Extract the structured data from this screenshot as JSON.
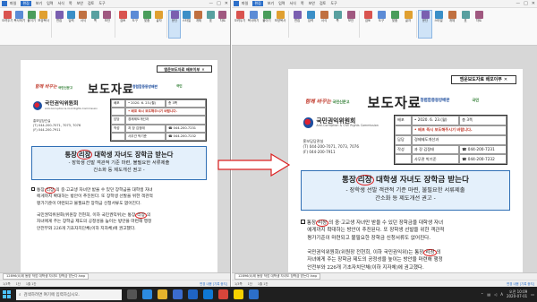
{
  "ribbon_buttons": [
    "오려두기",
    "복사하기",
    "붙이기",
    "모양복사",
    "편집",
    "입력",
    "서식",
    "쪽",
    "보안",
    "검토",
    "도구",
    "맞춤",
    "글자",
    "문단",
    "스타일",
    "개체",
    "표",
    "차트"
  ],
  "menu_items": [
    "파일",
    "편집",
    "보기",
    "입력",
    "서식",
    "쪽",
    "보안",
    "검토",
    "도구"
  ],
  "window_controls": [
    "ㅡ",
    "□",
    "✕"
  ],
  "left": {
    "doc_tab": "12896(0)제 동양 작업 대학생 자녀도 장학금 받는다.hwp",
    "status_page": "1/3쪽",
    "status_section": "1단",
    "status_line": "1줄 1칸",
    "status_mode": "변경 내용 [기록 중지]"
  },
  "right": {
    "doc_tab": "12896(0)제 동양 작업 대학생 자녀도 장학금 받는다.hwp",
    "status_page": "1/3쪽",
    "status_section": "1단",
    "status_line": "1줄 1칸",
    "status_mode": "변경 내용 [기록 중지]"
  },
  "doc": {
    "embargo": "엠운보도자료 배포이부",
    "embargo_close": "✕",
    "slogan": "함께 바꾸는",
    "small_logo": "국민신문고",
    "agency_logo": "청렴함중동방배판",
    "mark": "국민",
    "doc_type": "보도자료",
    "commission_ko": "국민권익위원회",
    "commission_en": "Anti-Corruption & Civil Rights Commission",
    "date_label": "배포",
    "date_value": "• 2020. 6. 23.(월)",
    "pages": "총 3쪽",
    "release": "• 배포 즉시 보도해주시기 바랍니다.",
    "contact_head": "홍보담당관실",
    "contact_tel": "(T) 044-200-7071, 7073, 7076",
    "contact_fax": "(F) 044-200-7911",
    "dept_label": "담당",
    "dept_name": "경제제도개선과",
    "writer_label": "작성",
    "staff1_role": "과 장 김정태",
    "staff1_tel": "☎ 044-200-7231",
    "staff2_role": "사무관 박기준",
    "staff2_tel": "☎ 044-200-7232",
    "title_pre": "통장",
    "title_circled": "리장",
    "title_post": "대학생 자녀도 장학금 받는다",
    "subtitle1": "- 장학생 선발 객관적 기준 마련, 불필요한 서류제출",
    "subtitle2": "간소화 등 제도개선 권고 -",
    "p1_l1_pre": "통장",
    "p1_l1_circled": "리장",
    "p1_l1_post": "의 중·고교생 자녀만 받을 수 있던 장학금을 대학생 자녀",
    "p1_l2": "에게까지 확대하는 방안이 추진된다. 또 장학생 선발을 위한 객관적",
    "p1_l3": "평가기준이 마련되고 불필요한 장학금 신청서류도 없어진다.",
    "p2_l1_pre": "국민권익위원회(위원장 전현희, 이하 국민권익위)는 통장",
    "p2_l1_circled": "리장",
    "p2_l1_post": "의",
    "p2_l2": "자녀에게 주는 장학금 제도의 공정성을 높이는 방안을 마련해 행정",
    "p2_l3": "안전부와 226개 기초자치단체(이하 지자체)에 권고했다."
  },
  "taskbar": {
    "search_placeholder": "검색하려면 여기에 입력하십시오.",
    "clock_time": "오전 10:09",
    "clock_date": "2020-07-01",
    "tray_lang": "A"
  },
  "colors": {
    "accent": "#2c6fc9",
    "title_box_bg": "#e4f0fb",
    "red": "#d22",
    "taskbar": "#1f1f1f"
  }
}
